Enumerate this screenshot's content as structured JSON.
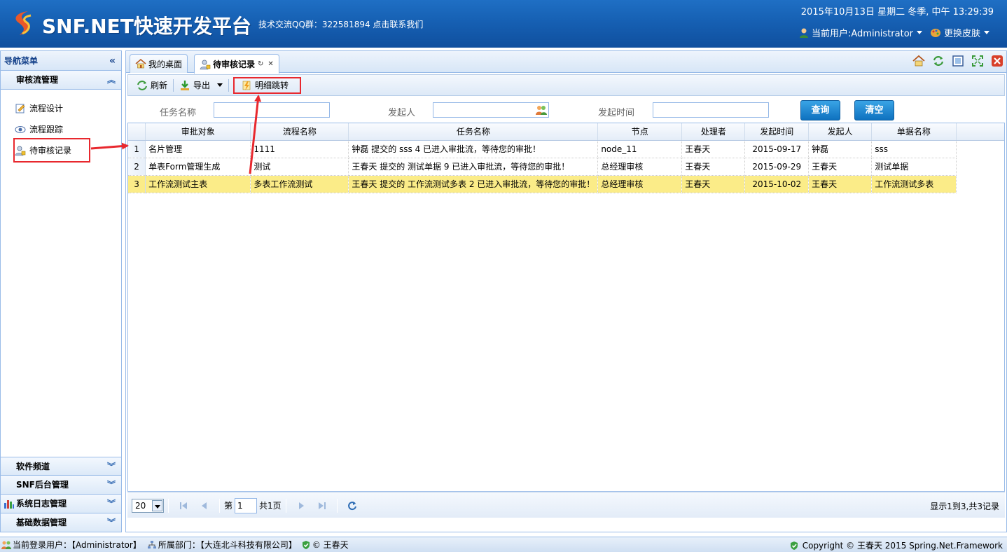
{
  "header": {
    "title": "SNF.NET快速开发平台",
    "qq_text": "技术交流QQ群：322581894 点击联系我们",
    "datetime": "2015年10月13日 星期二 冬季, 中午 13:29:39",
    "current_user": "当前用户:Administrator",
    "change_skin": "更换皮肤"
  },
  "nav": {
    "title": "导航菜单",
    "group_open": "审核流管理",
    "items": [
      {
        "label": "流程设计",
        "icon": "edit-doc-icon"
      },
      {
        "label": "流程跟踪",
        "icon": "eye-icon"
      },
      {
        "label": "待审核记录",
        "icon": "user-lock-icon"
      }
    ],
    "groups_collapsed": [
      "软件频道",
      "SNF后台管理",
      "系统日志管理",
      "基础数据管理"
    ]
  },
  "tabs": [
    {
      "label": "我的桌面",
      "icon": "home-icon"
    },
    {
      "label": "待审核记录",
      "icon": "user-lock-icon",
      "active": true
    }
  ],
  "toolbar": {
    "refresh": "刷新",
    "export": "导出",
    "detail_jump": "明细跳转"
  },
  "filter": {
    "task_name_label": "任务名称",
    "task_name_value": "",
    "initiator_label": "发起人",
    "initiator_value": "",
    "start_time_label": "发起时间",
    "start_time_value": "",
    "search_button": "查询",
    "clear_button": "清空"
  },
  "grid": {
    "columns": [
      "审批对象",
      "流程名称",
      "任务名称",
      "节点",
      "处理者",
      "发起时间",
      "发起人",
      "单据名称"
    ],
    "rows": [
      {
        "n": "1",
        "obj": "名片管理",
        "flow": "1111",
        "task": "钟磊 提交的 sss 4 已进入审批流，等待您的审批！",
        "node": "node_11",
        "handler": "王春天",
        "time": "2015-09-17",
        "initiator": "钟磊",
        "doc": "sss"
      },
      {
        "n": "2",
        "obj": "单表Form管理生成",
        "flow": "测试",
        "task": "王春天 提交的 测试单据 9 已进入审批流，等待您的审批！",
        "node": "总经理审核",
        "handler": "王春天",
        "time": "2015-09-29",
        "initiator": "王春天",
        "doc": "测试单据"
      },
      {
        "n": "3",
        "obj": "工作流测试主表",
        "flow": "多表工作流测试",
        "task": "王春天 提交的 工作流测试多表 2 已进入审批流，等待您的审批！",
        "node": "总经理审核",
        "handler": "王春天",
        "time": "2015-10-02",
        "initiator": "王春天",
        "doc": "工作流测试多表",
        "selected": true
      }
    ]
  },
  "pager": {
    "page_size": "20",
    "page_prefix": "第",
    "page_value": "1",
    "page_total": "共1页",
    "info": "显示1到3,共3记录"
  },
  "status": {
    "login_user": "当前登录用户：【Administrator】",
    "department": "所属部门：【大连北斗科技有限公司】",
    "author": "© 王春天",
    "copyright": "Copyright © 王春天 2015 Spring.Net.Framework"
  },
  "colors": {
    "header_blue": "#1660b3",
    "selected_row": "#fbec88",
    "annotation_red": "#e8282e",
    "button_blue": "#0e71bf"
  }
}
